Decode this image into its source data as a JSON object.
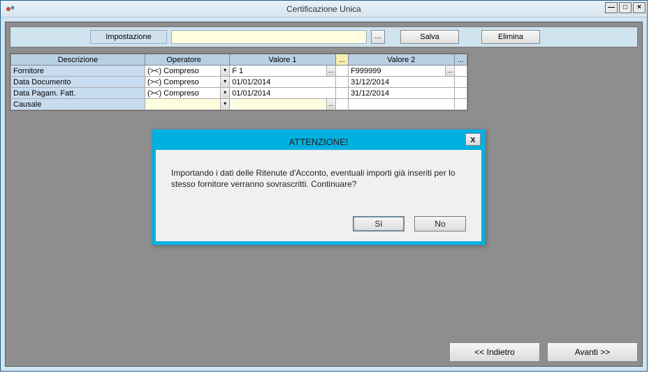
{
  "window": {
    "title": "Certificazione Unica"
  },
  "toolbar": {
    "impostazione_label": "Impostazione",
    "impostazione_value": "",
    "lookup": "...",
    "save_label": "Salva",
    "delete_label": "Elimina"
  },
  "grid": {
    "headers": {
      "descrizione": "Descrizione",
      "operatore": "Operatore",
      "valore1": "Valore 1",
      "valore2": "Valore 2",
      "lookup": "..."
    },
    "rows": [
      {
        "desc": "Fornitore",
        "op": "(><) Compreso",
        "v1": "F    1",
        "v2": "F999999",
        "v1_lookup": true,
        "v2_lookup": true
      },
      {
        "desc": "Data Documento",
        "op": "(><) Compreso",
        "v1": "01/01/2014",
        "v2": "31/12/2014",
        "v1_lookup": false,
        "v2_lookup": false
      },
      {
        "desc": "Data Pagam. Fatt.",
        "op": "(><) Compreso",
        "v1": "01/01/2014",
        "v2": "31/12/2014",
        "v1_lookup": false,
        "v2_lookup": false
      },
      {
        "desc": "Causale",
        "op": "",
        "v1": "",
        "v2": "",
        "v1_lookup": true,
        "v2_lookup": false,
        "yellow": true
      }
    ]
  },
  "footer": {
    "back": "<< Indietro",
    "next": "Avanti >>"
  },
  "modal": {
    "title": "ATTENZIONE!",
    "message": "Importando i dati delle Ritenute d'Acconto, eventuali importi già inseriti per lo stesso fornitore verranno sovrascritti. Continuare?",
    "yes": "Sì",
    "no": "No",
    "close": "x"
  }
}
